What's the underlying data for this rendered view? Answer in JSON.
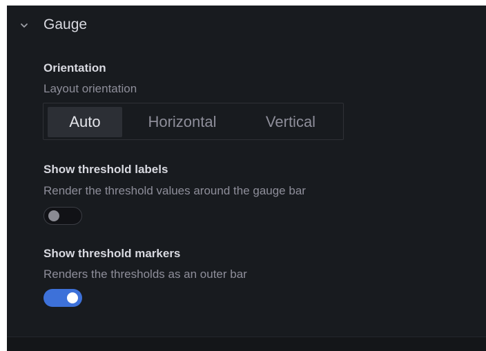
{
  "section": {
    "title": "Gauge",
    "expanded": true,
    "icon": "chevron-down-icon"
  },
  "orientation": {
    "label": "Orientation",
    "description": "Layout orientation",
    "options": [
      "Auto",
      "Horizontal",
      "Vertical"
    ],
    "selected": "Auto"
  },
  "threshold_labels": {
    "label": "Show threshold labels",
    "description": "Render the threshold values around the gauge bar",
    "enabled": false
  },
  "threshold_markers": {
    "label": "Show threshold markers",
    "description": "Renders the thresholds as an outer bar",
    "enabled": true
  },
  "colors": {
    "panel_bg": "#181b1f",
    "accent": "#3d71d9",
    "text_primary": "#d8d9e0",
    "text_secondary": "#8e8e9a"
  }
}
